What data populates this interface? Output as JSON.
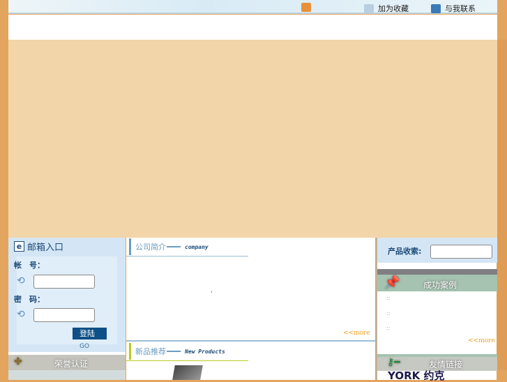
{
  "header": {
    "links": [
      {
        "label": "",
        "icon": "home-icon"
      },
      {
        "label": "加为收藏",
        "icon": "favorite-icon"
      },
      {
        "label": "与我联系",
        "icon": "contact-icon"
      }
    ]
  },
  "mail": {
    "title": "邮箱入口",
    "account_label": "帐　号：",
    "password_label": "密　码：",
    "account_value": "",
    "password_value": "",
    "login_label": "登陆",
    "login_suffix": "GO"
  },
  "honor": {
    "title": "荣誉认证"
  },
  "company": {
    "title": "公司简介",
    "english": "company",
    "body": "'",
    "more": "<<more"
  },
  "products": {
    "title": "新品推荐",
    "english": "New Products"
  },
  "search": {
    "label": "产品收索:",
    "value": ""
  },
  "cases": {
    "title": "成功案例",
    "items": [
      "",
      "",
      ""
    ],
    "more": "<<more"
  },
  "links": {
    "title": "友情链接",
    "logo_text": "YORK 约克"
  },
  "colors": {
    "accent": "#1c4a78",
    "more": "#f3a12a",
    "peach": "#f3d5aa",
    "border": "#de9c55"
  }
}
